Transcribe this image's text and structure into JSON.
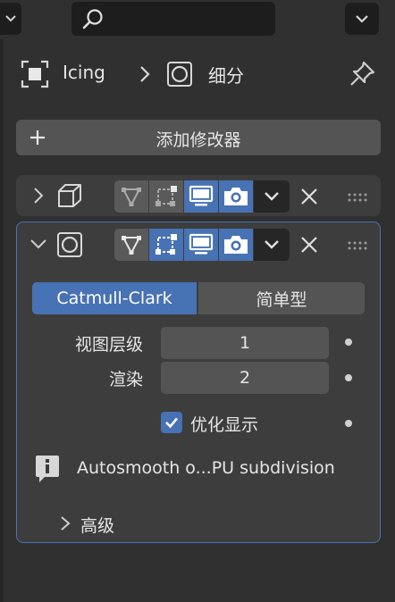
{
  "breadcrumb": {
    "object_name": "Icing",
    "modifier_name": "细分"
  },
  "add_modifier_label": "添加修改器",
  "subdivision": {
    "mode_options": [
      "Catmull-Clark",
      "简单型"
    ],
    "selected_mode": "Catmull-Clark",
    "viewport_levels_label": "视图层级",
    "viewport_levels_value": "1",
    "render_label": "渲染",
    "render_value": "2",
    "optimal_display_label": "优化显示",
    "optimal_display_checked": true,
    "info_text": "Autosmooth o...PU subdivision",
    "advanced_label": "高级"
  },
  "colors": {
    "background": "#303030",
    "panel": "#3d3d3d",
    "field": "#545454",
    "accent": "#4772b3",
    "dark_field": "#1d1d1d"
  },
  "icons": {
    "search": "magnifier-icon",
    "object": "object-square-icon",
    "modifier": "subdivision-circle-icon",
    "pin": "pin-icon",
    "plus": "plus-icon",
    "cube": "cube-icon",
    "edit_mode": "edit-mode-triangle-icon",
    "cage": "on-cage-icon",
    "viewport": "monitor-icon",
    "render": "camera-icon",
    "dropdown": "chevron-down-icon",
    "close": "close-x-icon",
    "drag": "drag-handle-icon",
    "info": "info-icon"
  }
}
